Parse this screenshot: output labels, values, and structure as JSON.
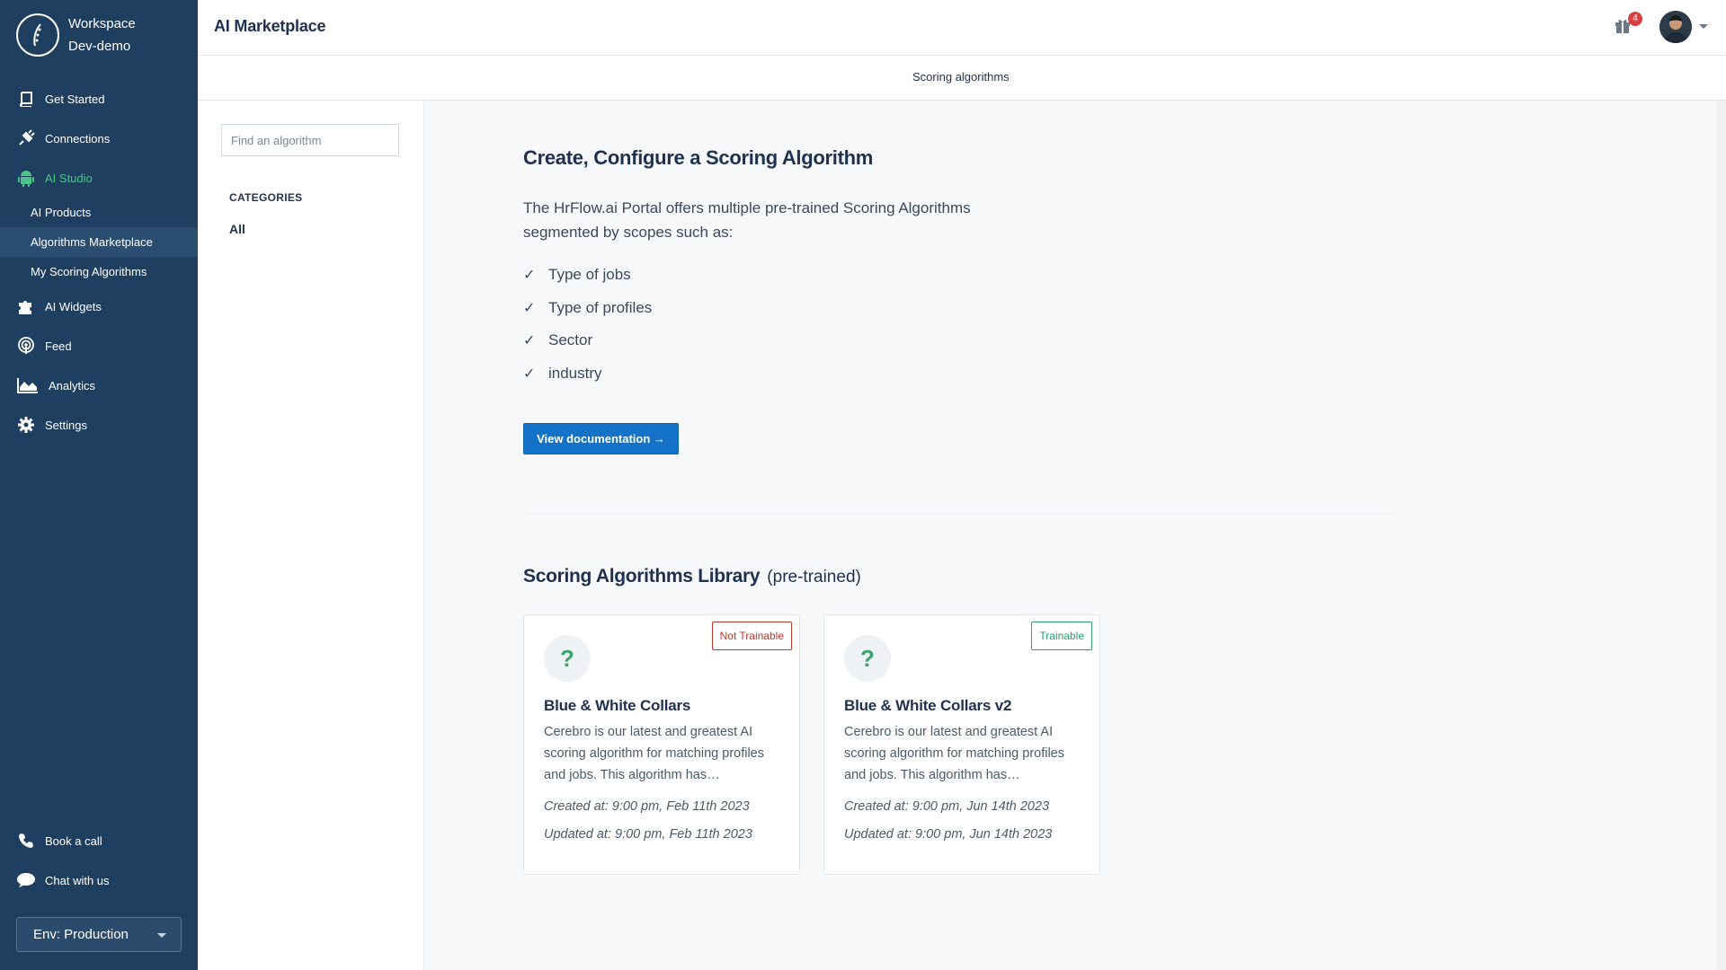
{
  "workspace": {
    "line1": "Workspace",
    "line2": "Dev-demo"
  },
  "sidebar": {
    "items": [
      {
        "label": "Get Started",
        "icon": "book-icon"
      },
      {
        "label": "Connections",
        "icon": "plug-icon"
      },
      {
        "label": "AI Studio",
        "icon": "android-icon",
        "active": true
      },
      {
        "label": "AI Widgets",
        "icon": "puzzle-icon"
      },
      {
        "label": "Feed",
        "icon": "podcast-icon"
      },
      {
        "label": "Analytics",
        "icon": "area-chart-icon"
      },
      {
        "label": "Settings",
        "icon": "gear-icon"
      }
    ],
    "subitems": [
      {
        "label": "AI Products"
      },
      {
        "label": "Algorithms Marketplace",
        "active": true
      },
      {
        "label": "My Scoring Algorithms"
      }
    ],
    "bottom": [
      {
        "label": "Book a call",
        "icon": "phone-icon"
      },
      {
        "label": "Chat with us",
        "icon": "chat-icon"
      }
    ],
    "env": "Env: Production"
  },
  "header": {
    "title": "AI Marketplace",
    "notification_count": "4"
  },
  "tabs": {
    "active": "Scoring algorithms"
  },
  "filter": {
    "search_placeholder": "Find an algorithm",
    "categories_heading": "CATEGORIES",
    "categories": [
      "All"
    ]
  },
  "intro": {
    "title": "Create, Configure a Scoring Algorithm",
    "text": "The HrFlow.ai Portal offers multiple pre-trained Scoring Algorithms segmented by scopes such as:",
    "checkmark": "✓",
    "scopes": [
      "Type of jobs",
      "Type of profiles",
      "Sector",
      "industry"
    ],
    "button": "View documentation →"
  },
  "library": {
    "title": "Scoring Algorithms Library",
    "subtitle": "(pre-trained)",
    "cards": [
      {
        "icon": "?",
        "tag": "Not Trainable",
        "name": "Blue & White Collars",
        "description": "Cerebro is our latest and greatest AI scoring algorithm for matching profiles and jobs. This algorithm has…",
        "created": "Created at: 9:00 pm, Feb 11th 2023",
        "updated": "Updated at: 9:00 pm, Feb 11th 2023"
      },
      {
        "icon": "?",
        "tag": "Trainable",
        "name": "Blue & White Collars v2",
        "description": "Cerebro is our latest and greatest AI scoring algorithm for matching profiles and jobs. This algorithm has…",
        "created": "Created at: 9:00 pm, Jun 14th 2023",
        "updated": "Updated at: 9:00 pm, Jun 14th 2023"
      }
    ]
  },
  "colors": {
    "sidebar": "#1f3f60",
    "active_green": "#4cc38a",
    "primary_button": "#1473c8",
    "not_trainable": "#c0392b",
    "trainable": "#2e9e6a"
  }
}
